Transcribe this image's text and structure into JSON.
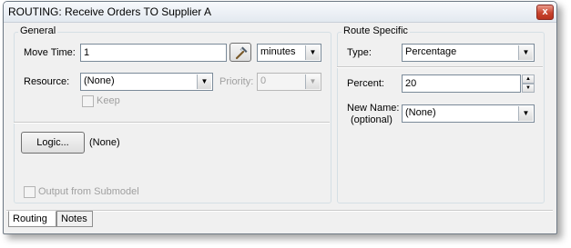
{
  "window": {
    "title": "ROUTING: Receive Orders TO Supplier A",
    "close_label": "x"
  },
  "general": {
    "legend": "General",
    "move_time_label": "Move Time:",
    "move_time_value": "1",
    "time_unit": "minutes",
    "resource_label": "Resource:",
    "resource_value": "(None)",
    "priority_label": "Priority:",
    "priority_value": "0",
    "keep_label": "Keep",
    "logic_button": "Logic...",
    "logic_value": "(None)",
    "output_label": "Output from Submodel"
  },
  "route_specific": {
    "legend": "Route Specific",
    "type_label": "Type:",
    "type_value": "Percentage",
    "percent_label": "Percent:",
    "percent_value": "20",
    "new_name_label_1": "New Name:",
    "new_name_label_2": "(optional)",
    "new_name_value": "(None)"
  },
  "tabs": [
    {
      "label": "Routing",
      "active": true
    },
    {
      "label": "Notes",
      "active": false
    }
  ]
}
